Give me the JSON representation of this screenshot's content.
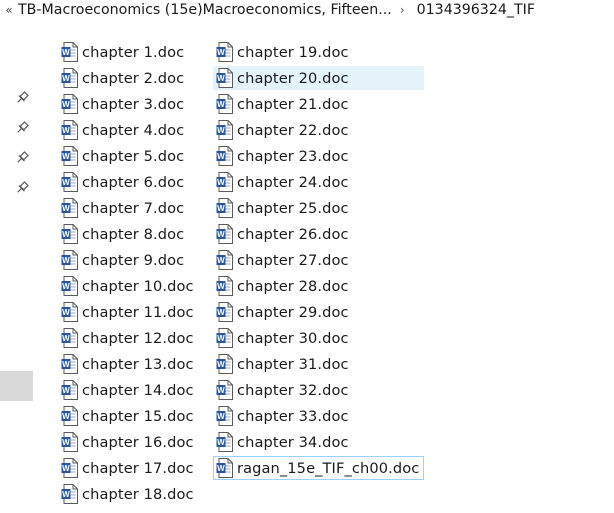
{
  "breadcrumb": {
    "overflow_glyph": "«",
    "separator_glyph": "›",
    "parts": [
      "TB-Macroeconomics (15e)Macroeconomics, Fifteen...",
      "0134396324_TIF"
    ]
  },
  "nav_pane": {
    "pin_icon_count": 4
  },
  "file_list": {
    "column_1": [
      "chapter 1.doc",
      "chapter 2.doc",
      "chapter 3.doc",
      "chapter 4.doc",
      "chapter 5.doc",
      "chapter 6.doc",
      "chapter 7.doc",
      "chapter 8.doc",
      "chapter 9.doc",
      "chapter 10.doc",
      "chapter 11.doc",
      "chapter 12.doc",
      "chapter 13.doc",
      "chapter 14.doc",
      "chapter 15.doc",
      "chapter 16.doc",
      "chapter 17.doc",
      "chapter 18.doc"
    ],
    "column_2": [
      "chapter 19.doc",
      "chapter 20.doc",
      "chapter 21.doc",
      "chapter 22.doc",
      "chapter 23.doc",
      "chapter 24.doc",
      "chapter 25.doc",
      "chapter 26.doc",
      "chapter 27.doc",
      "chapter 28.doc",
      "chapter 29.doc",
      "chapter 30.doc",
      "chapter 31.doc",
      "chapter 32.doc",
      "chapter 33.doc",
      "chapter 34.doc",
      "ragan_15e_TIF_ch00.doc"
    ],
    "hovered_item": "chapter 20.doc",
    "focused_item": "ragan_15e_TIF_ch00.doc",
    "file_icon": "word-document-icon"
  },
  "colors": {
    "hover_background": "#e5f3fb",
    "focus_border": "#99d1ff",
    "word_blue": "#2b579a",
    "nav_selected": "#d9d9d9"
  }
}
